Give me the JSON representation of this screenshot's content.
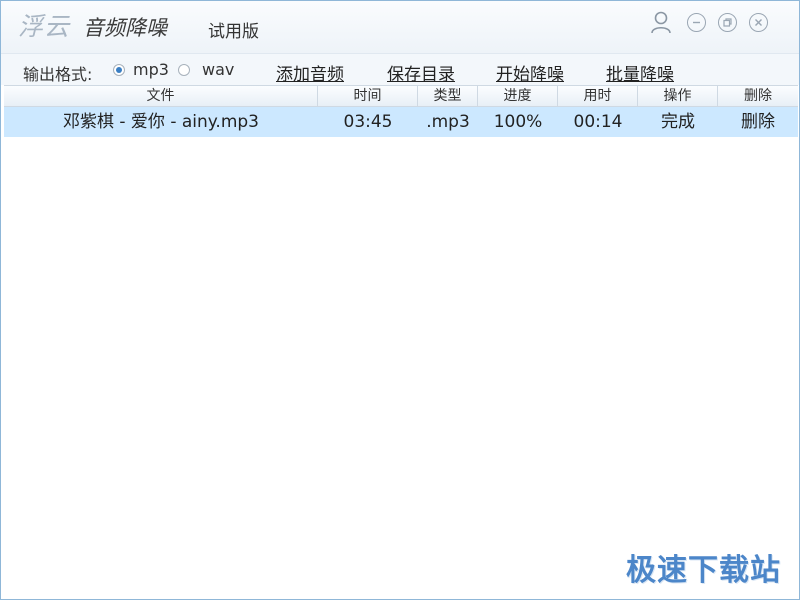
{
  "title": {
    "brand": "浮云",
    "product": "音频降噪",
    "edition": "试用版"
  },
  "window_controls": {
    "icons": [
      "user-icon",
      "minimize-icon",
      "restore-icon",
      "close-icon"
    ]
  },
  "toolbar": {
    "format_label": "输出格式:",
    "formats": [
      {
        "label": "mp3",
        "selected": true
      },
      {
        "label": "wav",
        "selected": false
      }
    ],
    "add_audio": "添加音频",
    "save_dir": "保存目录",
    "start_denoise": "开始降噪",
    "batch_denoise": "批量降噪"
  },
  "table": {
    "headers": {
      "file": "文件",
      "time": "时间",
      "type": "类型",
      "progress": "进度",
      "elapsed": "用时",
      "action": "操作",
      "delete": "删除"
    },
    "rows": [
      {
        "file": "邓紫棋 - 爱你 - ainy.mp3",
        "time": "03:45",
        "type": ".mp3",
        "progress": "100%",
        "elapsed": "00:14",
        "action": "完成",
        "delete": "删除"
      }
    ]
  },
  "watermark": "极速下载站",
  "colors": {
    "selected_row": "#cce8ff",
    "accent": "#3a7fc4",
    "watermark": "#4c86c9"
  }
}
